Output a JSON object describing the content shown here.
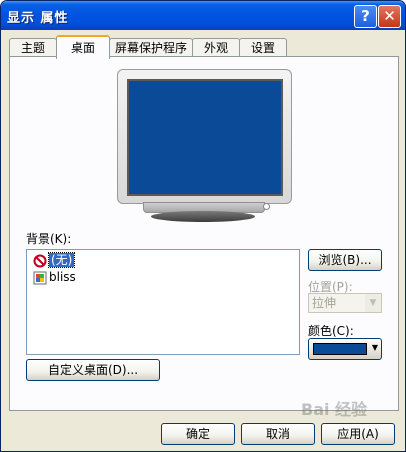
{
  "window": {
    "title": "显示 属性",
    "help_label": "?",
    "close_label": "✕"
  },
  "tabs": [
    {
      "label": "主题",
      "active": false
    },
    {
      "label": "桌面",
      "active": true
    },
    {
      "label": "屏幕保护程序",
      "active": false
    },
    {
      "label": "外观",
      "active": false
    },
    {
      "label": "设置",
      "active": false
    }
  ],
  "desktop": {
    "background_label": "背景(K):",
    "background_items": [
      {
        "label": "(无)",
        "icon": "none-icon",
        "selected": true
      },
      {
        "label": "bliss",
        "icon": "image-file-icon",
        "selected": false
      }
    ],
    "browse_label": "浏览(B)...",
    "position_label": "位置(P):",
    "position_value": "拉伸",
    "color_label": "颜色(C):",
    "color_value": "#0b4a96",
    "customize_label": "自定义桌面(D)..."
  },
  "buttons": {
    "ok_label": "确定",
    "cancel_label": "取消",
    "apply_label": "应用(A)"
  },
  "watermark_text": "Bai 经验"
}
